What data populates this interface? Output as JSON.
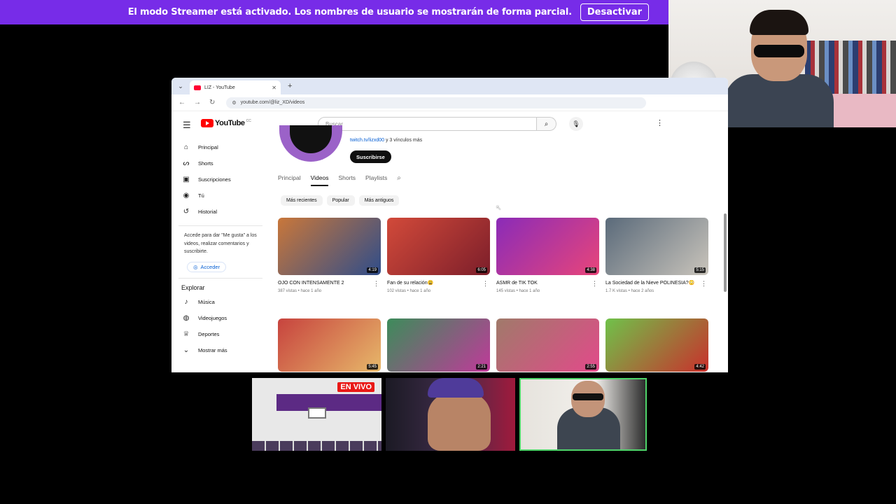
{
  "banner": {
    "text": "El modo Streamer está activado. Los nombres de usuario se mostrarán de forma parcial.",
    "button": "Desactivar"
  },
  "browser": {
    "tab_title": "LIZ - YouTube",
    "url": "youtube.com/@liz_XD/videos"
  },
  "youtube": {
    "logo": "YouTube",
    "logo_suffix": "CC",
    "search_placeholder": "Buscar",
    "sidebar": {
      "items": [
        {
          "label": "Principal",
          "icon": "home-icon"
        },
        {
          "label": "Shorts",
          "icon": "shorts-icon"
        },
        {
          "label": "Suscripciones",
          "icon": "subscriptions-icon"
        },
        {
          "label": "Tú",
          "icon": "you-icon"
        },
        {
          "label": "Historial",
          "icon": "history-icon"
        }
      ],
      "note": "Accede para dar \"Me gusta\" a los videos, realizar comentarios y suscribirte.",
      "login": "Acceder",
      "explore_title": "Explorar",
      "explore": [
        {
          "label": "Música",
          "icon": "music-icon"
        },
        {
          "label": "Videojuegos",
          "icon": "gaming-icon"
        },
        {
          "label": "Deportes",
          "icon": "trophy-icon"
        },
        {
          "label": "Mostrar más",
          "icon": "chevron-down-icon"
        }
      ]
    },
    "channel": {
      "link": "twitch.tv/lizxd00",
      "link_suffix": "y 3 vínculos más",
      "subscribe": "Suscribirse"
    },
    "tabs": [
      "Principal",
      "Videos",
      "Shorts",
      "Playlists"
    ],
    "active_tab": "Videos",
    "chips": [
      "Más recientes",
      "Popular",
      "Más antiguos"
    ],
    "videos": [
      {
        "title": "OJO CON INTENSAMENTE 2",
        "meta": "387 vistas • hace 1 año",
        "duration": "4:19",
        "color1": "#c9773a",
        "color2": "#2f4d8a"
      },
      {
        "title": "Fan de su relación😩",
        "meta": "102 vistas • hace 1 año",
        "duration": "6:05",
        "color1": "#d24a3a",
        "color2": "#7c1e2a"
      },
      {
        "title": "ASMR de TIK TOK",
        "meta": "145 vistas • hace 1 año",
        "duration": "4:38",
        "color1": "#8a2bb8",
        "color2": "#e8457a"
      },
      {
        "title": "La Sociedad de la Nieve POLINESIA?😳",
        "meta": "1.7 K vistas • hace 2 años",
        "duration": "5:15",
        "color1": "#5a6a7a",
        "color2": "#c9c4bb"
      }
    ],
    "videos_row2": [
      {
        "duration": "5:45",
        "color1": "#c7433e",
        "color2": "#e7b86a"
      },
      {
        "duration": "2:21",
        "color1": "#3c8c5a",
        "color2": "#c03a9a"
      },
      {
        "duration": "2:55",
        "color1": "#a07a6a",
        "color2": "#e24a8a"
      },
      {
        "duration": "4:42",
        "color1": "#6fc24a",
        "color2": "#c9302c"
      }
    ]
  },
  "panels": {
    "live_badge": "EN VIVO"
  }
}
